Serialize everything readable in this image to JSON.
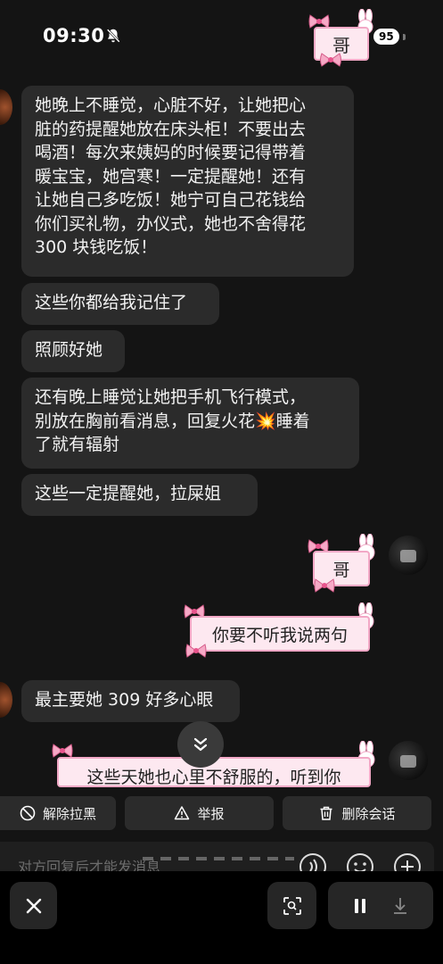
{
  "status_bar": {
    "time": "09:30",
    "battery": "95",
    "contact_name": "哥"
  },
  "messages": {
    "m1_lines": [
      "她晚上不睡觉，心脏不好，让她把心",
      "脏的药提醒她放在床头柜！不要出去",
      "喝酒！每次来姨妈的时候要记得带着",
      "暖宝宝，她宫寒！一定提醒她！还有",
      "让她自己多吃饭！她宁可自己花钱给",
      "你们买礼物，办仪式，她也不舍得花",
      "300 块钱吃饭！"
    ],
    "m2": "这些你都给我记住了",
    "m3": "照顾好她",
    "m4_lines": [
      "还有晚上睡觉让她把手机飞行模式，",
      "别放在胸前看消息，回复火花💥睡着",
      "了就有辐射"
    ],
    "m5": "这些一定提醒她，拉屎姐",
    "out1": "哥",
    "out2": "你要不听我说两句",
    "m6": "最主要她 309 好多心眼",
    "out3": "这些天她也心里不舒服的，听到你"
  },
  "actions": {
    "unblock": "解除拉黑",
    "report": "举报",
    "delete_chat": "删除会话"
  },
  "input": {
    "placeholder": "对方回复后才能发消息"
  },
  "colors": {
    "background": "#141414",
    "bubble_in": "#2b2b2b",
    "bubble_pink": "#fde8f0",
    "pink_border": "#f2a8c6",
    "accent_pink": "#e8558d"
  },
  "icons": [
    "bell-slash-icon",
    "chevron-double-down-icon",
    "block-icon",
    "warning-icon",
    "trash-icon",
    "voice-icon",
    "emoji-icon",
    "plus-icon",
    "close-icon",
    "scan-icon",
    "pause-icon",
    "download-icon"
  ]
}
